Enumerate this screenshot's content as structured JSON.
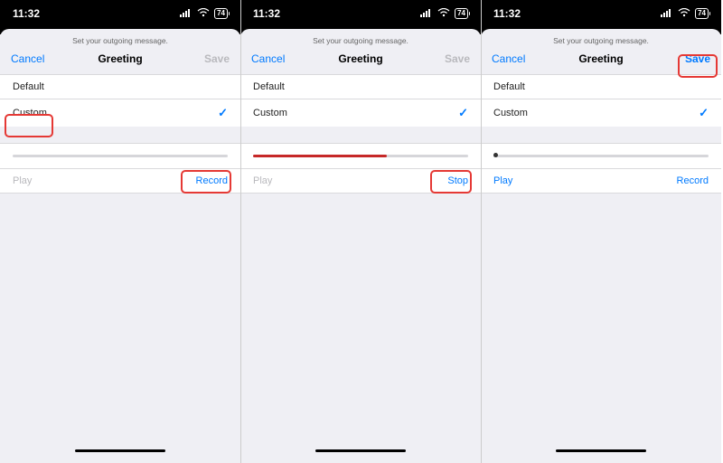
{
  "shared": {
    "time": "11:32",
    "battery": "74",
    "subtitle": "Set your outgoing message.",
    "title": "Greeting",
    "cancel": "Cancel",
    "save": "Save",
    "row_default": "Default",
    "row_custom": "Custom",
    "checkmark": "✓",
    "play": "Play",
    "record": "Record",
    "stop": "Stop"
  },
  "screens": [
    {
      "save_enabled": false,
      "play_enabled": false,
      "right_action": "Record",
      "progress_pct": 0,
      "progress_style": "none",
      "highlights": [
        "custom-row",
        "action-right"
      ]
    },
    {
      "save_enabled": false,
      "play_enabled": false,
      "right_action": "Stop",
      "progress_pct": 62,
      "progress_style": "red",
      "highlights": [
        "action-right"
      ]
    },
    {
      "save_enabled": true,
      "play_enabled": true,
      "right_action": "Record",
      "progress_pct": 0,
      "progress_style": "dot",
      "highlights": [
        "save-button"
      ]
    }
  ]
}
